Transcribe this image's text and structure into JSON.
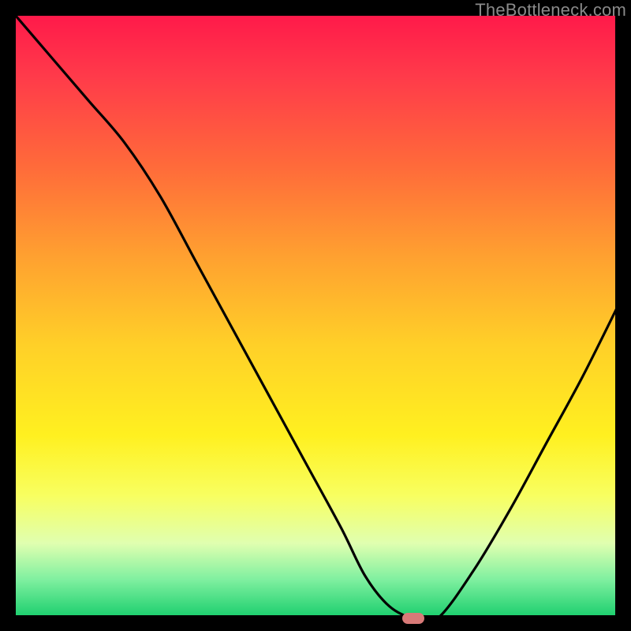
{
  "watermark": "TheBottleneck.com",
  "chart_data": {
    "type": "line",
    "title": "",
    "xlabel": "",
    "ylabel": "",
    "xlim": [
      0,
      100
    ],
    "ylim": [
      0,
      100
    ],
    "grid": false,
    "legend": false,
    "background": "red-yellow-green vertical gradient",
    "series": [
      {
        "name": "curve",
        "color": "#000000",
        "x": [
          0,
          6,
          12,
          18,
          24,
          30,
          36,
          42,
          48,
          54,
          58,
          62,
          66,
          70,
          76,
          82,
          88,
          94,
          100
        ],
        "y": [
          100,
          93,
          86,
          79,
          70,
          59,
          48,
          37,
          26,
          15,
          7,
          2,
          0,
          0,
          8,
          18,
          29,
          40,
          52
        ]
      }
    ],
    "marker": {
      "x": 66,
      "y": 0,
      "color": "#d87a78",
      "shape": "pill"
    }
  }
}
